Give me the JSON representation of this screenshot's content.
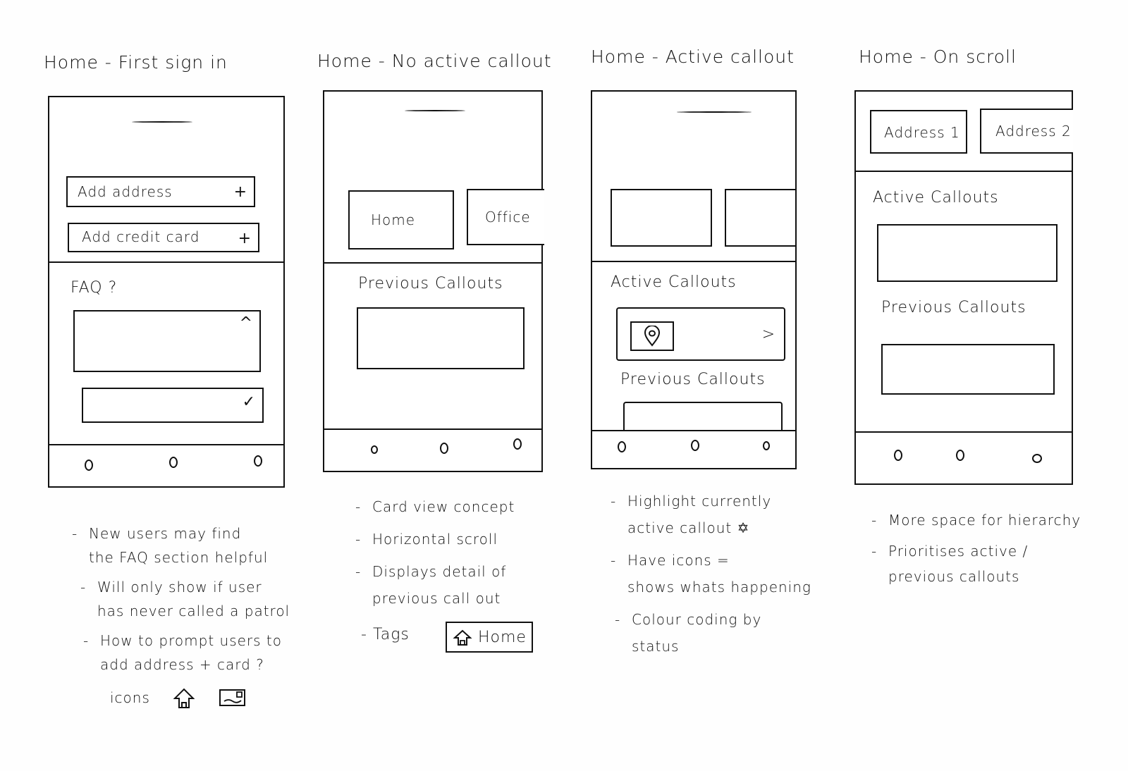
{
  "screens": [
    {
      "title": "Home - First sign in",
      "rows": [
        {
          "label": "Add address",
          "icon": "plus"
        },
        {
          "label": "Add credit card",
          "icon": "plus"
        }
      ],
      "section_title": "FAQ ?",
      "faq_items": [
        {
          "state": "expanded",
          "icon": "chevron-up"
        },
        {
          "state": "collapsed",
          "icon": "chevron-down"
        }
      ],
      "notes": [
        [
          "New users may find",
          "the FAQ section helpful"
        ],
        [
          "Will only show if user",
          "has never called a patrol"
        ],
        [
          "How to prompt users to",
          "add address + card ?"
        ]
      ],
      "icons_label": "icons",
      "icon_examples": [
        "home-icon",
        "credit-card-icon"
      ]
    },
    {
      "title": "Home - No active callout",
      "cards": [
        "Home",
        "Office"
      ],
      "section_title": "Previous Callouts",
      "notes": [
        [
          "Card view concept"
        ],
        [
          "Horizontal scroll"
        ],
        [
          "Displays detail of",
          "previous call out"
        ]
      ],
      "tags_label": "Tags",
      "tag_example": "Home"
    },
    {
      "title": "Home - Active callout",
      "cards": [
        "",
        ""
      ],
      "active_section_title": "Active Callouts",
      "previous_section_title": "Previous Callouts",
      "notes": [
        [
          "Highlight currently",
          "active callout ✡"
        ],
        [
          "Have icons =",
          "shows whats happening"
        ],
        [
          "Colour coding by",
          "status"
        ]
      ]
    },
    {
      "title": "Home - On scroll",
      "cards": [
        "Address 1",
        "Address 2"
      ],
      "active_section_title": "Active Callouts",
      "previous_section_title": "Previous Callouts",
      "notes": [
        [
          "More space for hierarchy"
        ],
        [
          "Prioritises active /",
          "previous callouts"
        ]
      ]
    }
  ],
  "glyphs": {
    "plus": "+",
    "chevron_up": "^",
    "check": "✓",
    "chevron_right": ">",
    "nav_dot": "o"
  }
}
